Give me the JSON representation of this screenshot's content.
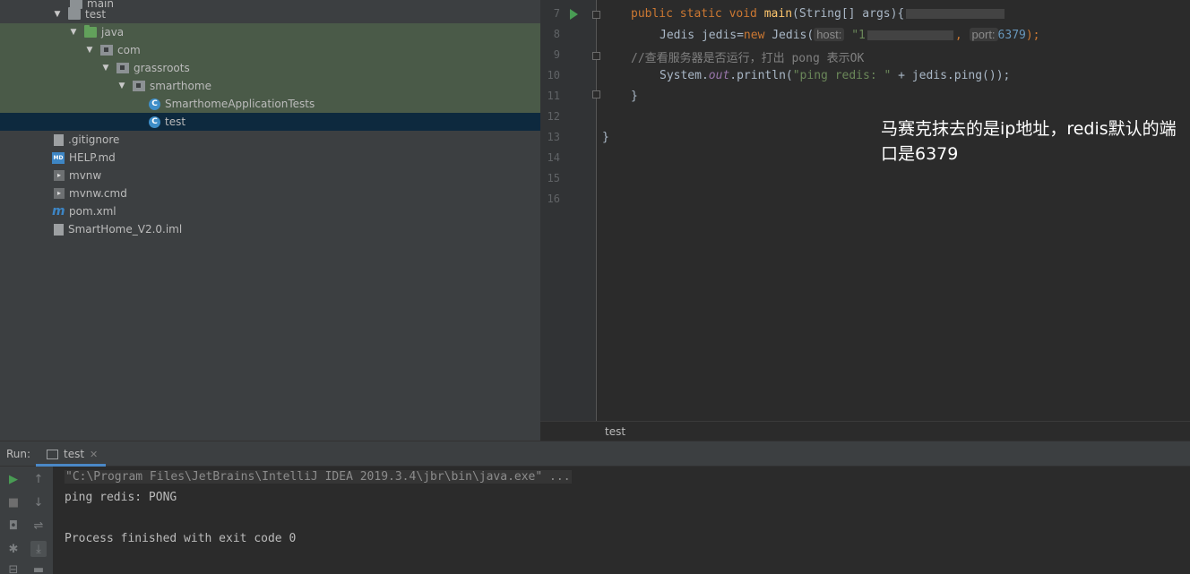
{
  "tree": {
    "items": [
      {
        "label": "main",
        "icon": "folder-icon"
      },
      {
        "label": "test",
        "icon": "folder-icon"
      },
      {
        "label": "java",
        "icon": "source-folder-icon"
      },
      {
        "label": "com",
        "icon": "package-icon"
      },
      {
        "label": "grassroots",
        "icon": "package-icon"
      },
      {
        "label": "smarthome",
        "icon": "package-icon"
      },
      {
        "label": "SmarthomeApplicationTests",
        "icon": "class-icon"
      },
      {
        "label": "test",
        "icon": "class-icon"
      },
      {
        "label": ".gitignore",
        "icon": "file-icon"
      },
      {
        "label": "HELP.md",
        "icon": "markdown-icon"
      },
      {
        "label": "mvnw",
        "icon": "script-icon"
      },
      {
        "label": "mvnw.cmd",
        "icon": "script-icon"
      },
      {
        "label": "pom.xml",
        "icon": "maven-icon"
      },
      {
        "label": "SmartHome_V2.0.iml",
        "icon": "module-file-icon"
      }
    ]
  },
  "editor": {
    "line_numbers": [
      "7",
      "8",
      "9",
      "10",
      "11",
      "12",
      "13",
      "14",
      "15",
      "16"
    ],
    "line7": {
      "kw": "public static void ",
      "fn": "main",
      "rest": "(String[] args){"
    },
    "line8": {
      "pre": "Jedis jedis=",
      "kw": "new",
      "mid": " Jedis(",
      "hint_host": "host:",
      "str": " \"1",
      "comma": ",",
      "hint_port": "port:",
      "num": "6379",
      "end": ");"
    },
    "line9": {
      "comment": "//查看服务器是否运行，打出 pong 表示OK"
    },
    "line10": {
      "pre": "System.",
      "field": "out",
      "mid": ".println(",
      "str": "\"ping redis: \"",
      "end": " + jedis.ping());"
    },
    "line11": "}",
    "line13": "}",
    "annotation": "马赛克抹去的是ip地址，redis默认的端口是6379",
    "breadcrumb": "test"
  },
  "run": {
    "label": "Run:",
    "tab": "test",
    "lines": [
      "\"C:\\Program Files\\JetBrains\\IntelliJ IDEA 2019.3.4\\jbr\\bin\\java.exe\" ...",
      "ping redis: PONG",
      "",
      "Process finished with exit code 0"
    ]
  },
  "colors": {
    "run_green": "#499c54",
    "selection": "#0d293e",
    "test_source_bg": "#4a5a48",
    "tab_underline": "#4a88c7"
  }
}
